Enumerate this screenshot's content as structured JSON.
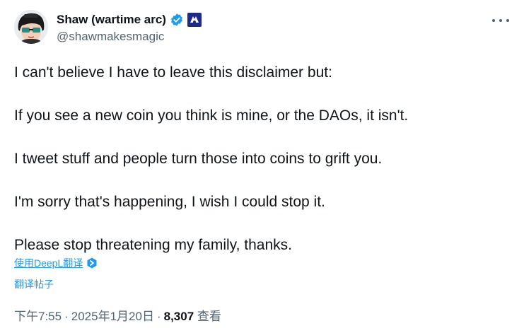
{
  "author": {
    "display_name": "Shaw (wartime arc)",
    "handle": "@shawmakesmagic",
    "verified_color": "#1d9bf0"
  },
  "tweet": {
    "paragraphs": [
      "I can't believe I have to leave this disclaimer but:",
      "If you see a new coin you think is mine, or the DAOs, it isn't.",
      "I tweet stuff and people turn those into coins to grift you.",
      "I'm sorry that's happening, I wish I could stop it.",
      "Please stop threatening my family, thanks."
    ]
  },
  "translate": {
    "deepl_label": "使用DeepL翻译",
    "post_label": "翻译帖子"
  },
  "meta": {
    "time": "下午7:55",
    "date": "2025年1月20日",
    "separator": "·",
    "views_count": "8,307",
    "views_label": "查看"
  },
  "icons": {
    "more": "more-horizontal-icon",
    "verified": "verified-badge-icon",
    "affiliate": "affiliate-badge-icon",
    "deepl": "deepl-icon"
  }
}
